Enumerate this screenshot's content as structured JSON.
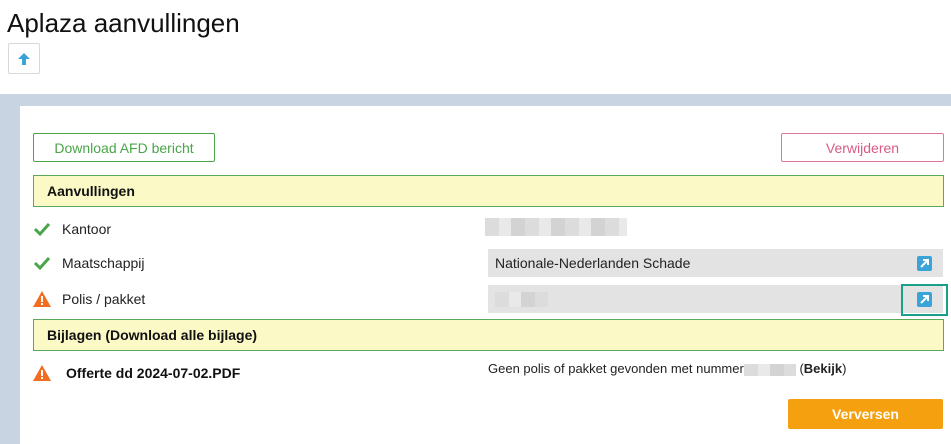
{
  "page": {
    "title": "Aplaza aanvullingen"
  },
  "toolbar": {
    "up_icon": "arrow-up-icon",
    "download_label": "Download AFD bericht",
    "delete_label": "Verwijderen"
  },
  "sections": {
    "aanvullingen": "Aanvullingen",
    "bijlagen": "Bijlagen (Download alle bijlage)"
  },
  "rows": [
    {
      "label": "Kantoor",
      "status_icon": "check-icon",
      "value": ""
    },
    {
      "label": "Maatschappij",
      "status_icon": "check-icon",
      "value": "Nationale-Nederlanden Schade"
    },
    {
      "label": "Polis / pakket",
      "status_icon": "warning-icon",
      "value": ""
    }
  ],
  "attachments": [
    {
      "name": "Offerte dd 2024-07-02.PDF",
      "status_icon": "warning-icon",
      "message_prefix": "Geen polis of pakket gevonden met nummer",
      "link_open": "(",
      "link_label": "Bekijk",
      "link_close": ")"
    }
  ],
  "actions": {
    "refresh_label": "Verversen"
  },
  "colors": {
    "success": "#4aa54a",
    "danger": "#d85b85",
    "warning": "#f36d21",
    "accent": "#f5a00f",
    "section_bg": "#fbf9c6",
    "link_icon": "#3aa3d8"
  }
}
